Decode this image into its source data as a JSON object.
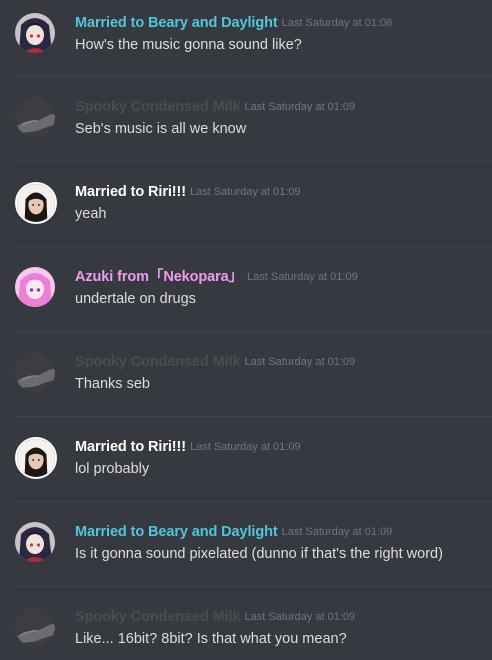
{
  "colors": {
    "background": "#36393f",
    "cyan_author": "#4fc6dc",
    "faded_author": "#4a4d52",
    "white_author": "#ffffff",
    "pink_author": "#f29af2",
    "timestamp": "#72767d",
    "text": "#dcddde"
  },
  "messages": [
    {
      "author": "Married to Beary and Daylight",
      "author_color": "#4fc6dc",
      "avatar": "anime-dark-hair-avatar",
      "timestamp": "Last Saturday at 01:08",
      "content": "How's the music gonna sound like?"
    },
    {
      "author": "Spooky Condensed Milk",
      "author_color": "#4a4d52",
      "avatar": "gray-hand-avatar",
      "timestamp": "Last Saturday at 01:09",
      "content": "Seb's music is all we know"
    },
    {
      "author": "Married to Riri!!!",
      "author_color": "#ffffff",
      "avatar": "girl-photo-avatar",
      "timestamp": "Last Saturday at 01:09",
      "content": "yeah"
    },
    {
      "author": "Azuki from「Nekopara」",
      "author_color": "#f29af2",
      "avatar": "pink-anime-avatar",
      "timestamp": "Last Saturday at 01:09",
      "content": "undertale on drugs"
    },
    {
      "author": "Spooky Condensed Milk",
      "author_color": "#4a4d52",
      "avatar": "gray-hand-avatar",
      "timestamp": "Last Saturday at 01:09",
      "content": "Thanks seb"
    },
    {
      "author": "Married to Riri!!!",
      "author_color": "#ffffff",
      "avatar": "girl-photo-avatar",
      "timestamp": "Last Saturday at 01:09",
      "content": "lol probably"
    },
    {
      "author": "Married to Beary and Daylight",
      "author_color": "#4fc6dc",
      "avatar": "anime-dark-hair-avatar",
      "timestamp": "Last Saturday at 01:09",
      "content": "Is it gonna sound pixelated (dunno if that's the right word)"
    },
    {
      "author": "Spooky Condensed Milk",
      "author_color": "#4a4d52",
      "avatar": "gray-hand-avatar",
      "timestamp": "Last Saturday at 01:09",
      "content": "Like... 16bit? 8bit? Is that what you mean?"
    }
  ]
}
